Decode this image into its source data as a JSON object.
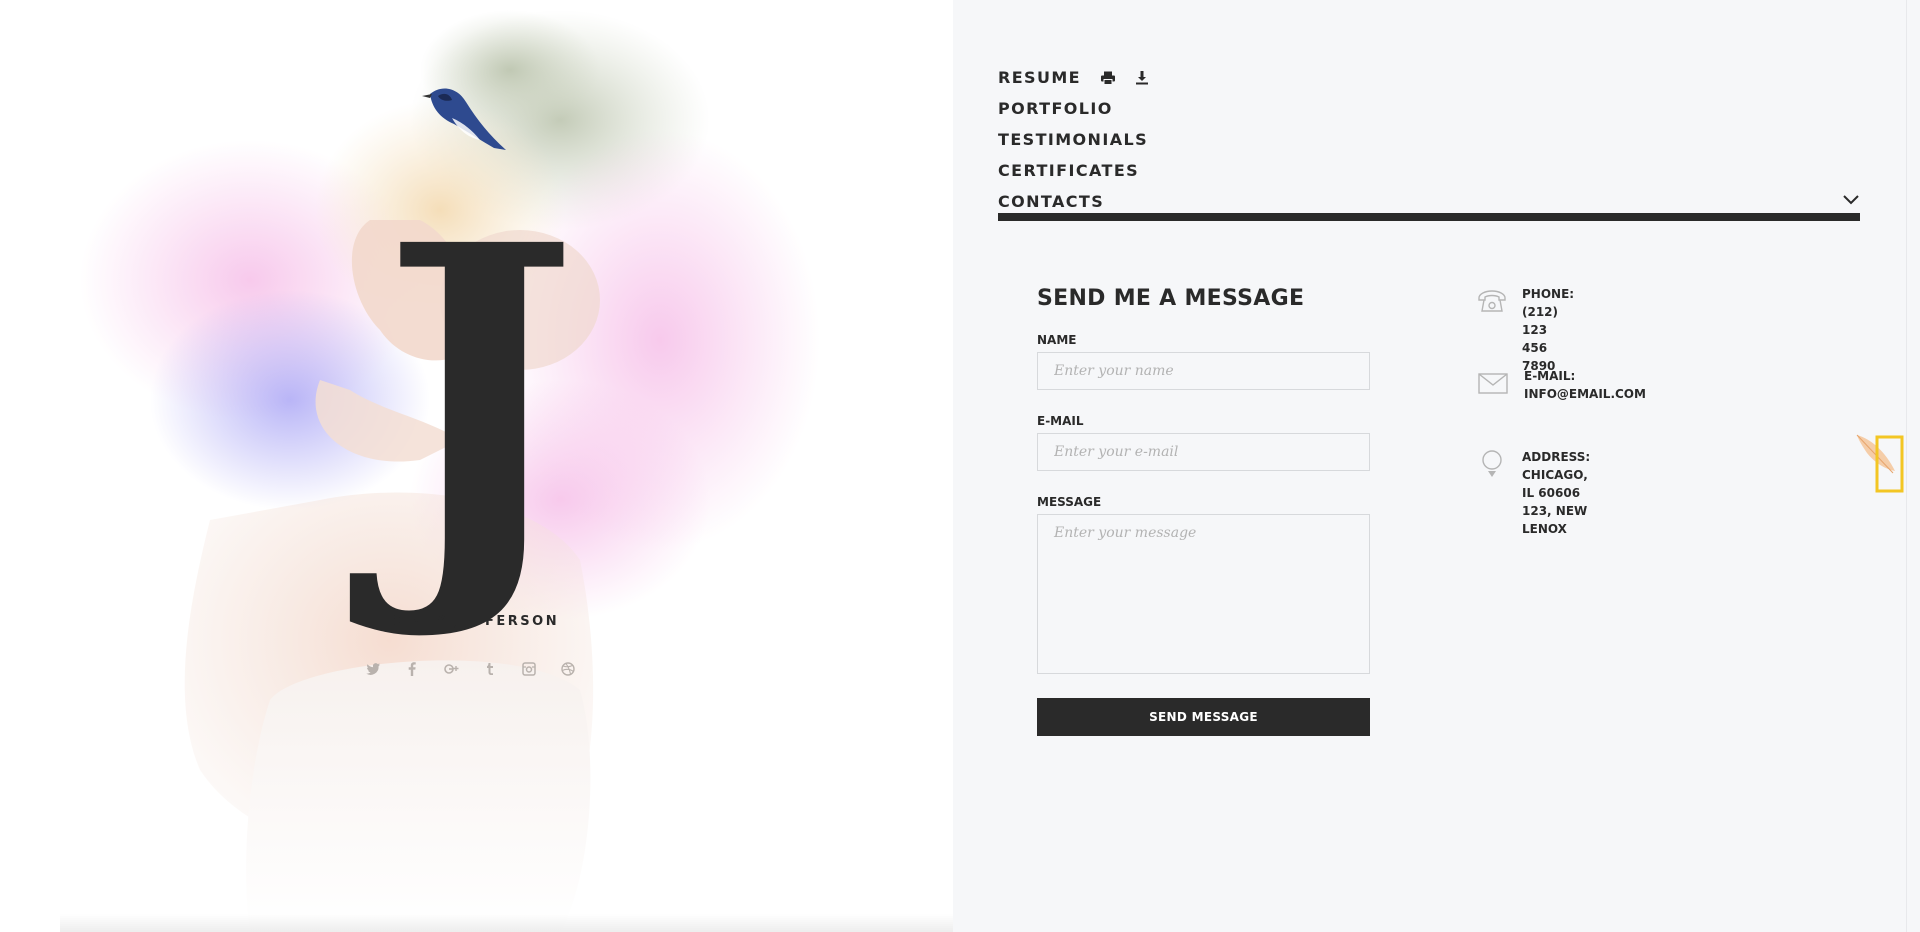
{
  "hero": {
    "monogram": "J",
    "name": "CINDY JEFFERSON",
    "social_icons": [
      "twitter-icon",
      "facebook-icon",
      "google-plus-icon",
      "tumblr-icon",
      "instagram-icon",
      "dribbble-icon"
    ]
  },
  "nav": {
    "items": [
      {
        "label": "RESUME",
        "icons": [
          "print-icon",
          "download-icon"
        ]
      },
      {
        "label": "PORTFOLIO"
      },
      {
        "label": "TESTIMONIALS"
      },
      {
        "label": "CERTIFICATES"
      },
      {
        "label": "CONTACTS",
        "active": true,
        "icon": "chevron-down-icon"
      }
    ]
  },
  "form": {
    "title": "SEND ME A MESSAGE",
    "name_label": "NAME",
    "name_placeholder": "Enter your name",
    "email_label": "E-MAIL",
    "email_placeholder": "Enter your e-mail",
    "message_label": "MESSAGE",
    "message_placeholder": "Enter your message",
    "submit_label": "SEND MESSAGE"
  },
  "contact": {
    "phone_label": "PHONE:",
    "phone_value": "(212) 123 456 7890",
    "email_label": "E-MAIL:",
    "email_value": "INFO@EMAIL.COM",
    "address_label": "ADDRESS:",
    "address_value": "CHICAGO, IL 60606 123, NEW LENOX"
  },
  "colors": {
    "text_dark": "#2a2a2a",
    "panel_bg": "#f6f7f9",
    "accent_yellow": "#f3c623",
    "input_border": "#d7d9dc"
  }
}
